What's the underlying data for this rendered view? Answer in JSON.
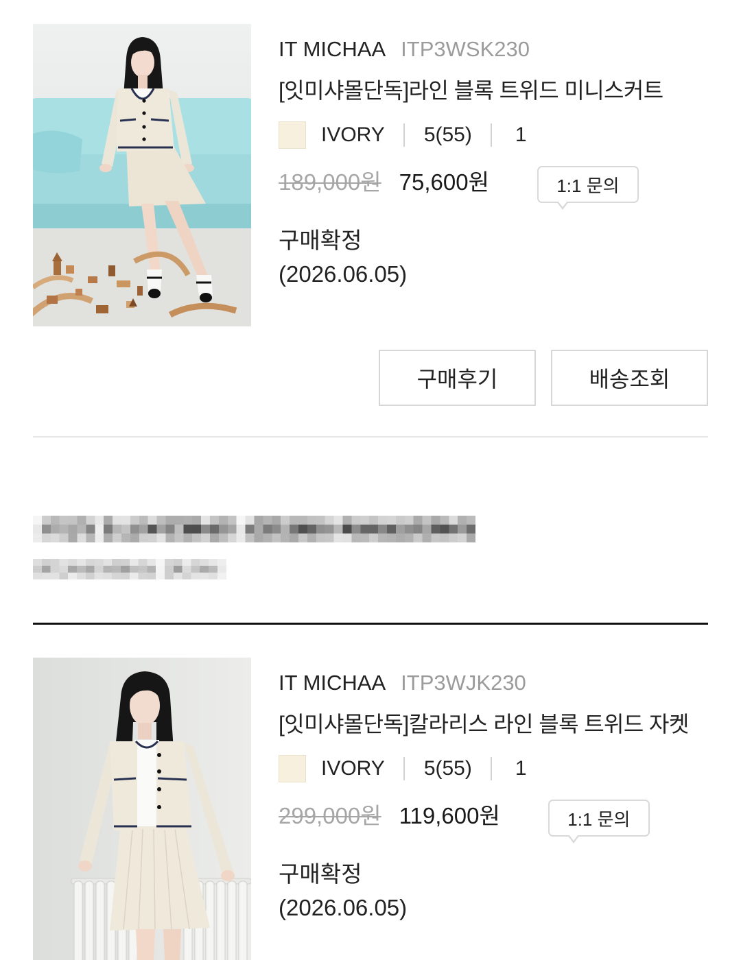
{
  "theme": {
    "text": "#222222",
    "muted": "#9b9b9b",
    "strike": "#a6a6a6",
    "border": "#d9d9d9",
    "divider_light": "#e6e6e6",
    "divider_dark": "#111111"
  },
  "items": [
    {
      "brand": "IT MICHAA",
      "product_code": "ITP3WSK230",
      "title": "[잇미샤몰단독]라인 블록 트위드 미니스커트",
      "color_swatch": "#f7f0de",
      "color_name": "IVORY",
      "size": "5(55)",
      "quantity": "1",
      "original_price": "189,000원",
      "sale_price": "75,600원",
      "inquiry_label": "1:1 문의",
      "status": "구매확정",
      "status_date": "(2026.06.05)",
      "actions": [
        "구매후기",
        "배송조회"
      ]
    },
    {
      "brand": "IT MICHAA",
      "product_code": "ITP3WJK230",
      "title": "[잇미샤몰단독]칼라리스 라인 블록 트위드 자켓",
      "color_swatch": "#f7f0de",
      "color_name": "IVORY",
      "size": "5(55)",
      "quantity": "1",
      "original_price": "299,000원",
      "sale_price": "119,600원",
      "inquiry_label": "1:1 문의",
      "status": "구매확정",
      "status_date": "(2026.06.05)"
    }
  ]
}
